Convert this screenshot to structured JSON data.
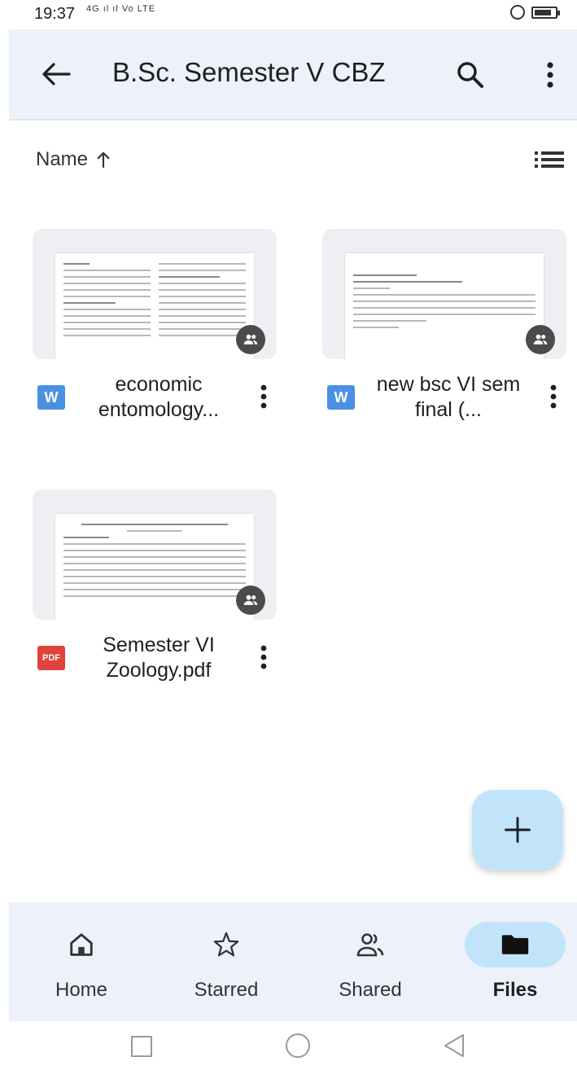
{
  "status_bar": {
    "time": "19:37",
    "network": "4G ıl ıl Vo LTE"
  },
  "app_bar": {
    "title": "B.Sc. Semester V CBZ",
    "back_icon": "arrow-left-icon",
    "search_icon": "search-icon",
    "more_icon": "more-vert-icon"
  },
  "sort": {
    "label": "Name",
    "direction_icon": "arrow-up-icon",
    "view_toggle_icon": "list-view-icon"
  },
  "files": [
    {
      "name": "economic entomology...",
      "type": "word",
      "type_label": "W",
      "shared": true
    },
    {
      "name": "new bsc VI sem final (...",
      "type": "word",
      "type_label": "W",
      "shared": true
    },
    {
      "name": "Semester VI Zoology.pdf",
      "type": "pdf",
      "type_label": "PDF",
      "shared": true
    }
  ],
  "fab": {
    "icon": "plus-icon"
  },
  "bottom_nav": {
    "items": [
      {
        "label": "Home",
        "icon": "home-icon",
        "active": false
      },
      {
        "label": "Starred",
        "icon": "star-icon",
        "active": false
      },
      {
        "label": "Shared",
        "icon": "shared-people-icon",
        "active": false
      },
      {
        "label": "Files",
        "icon": "folder-icon",
        "active": true
      }
    ]
  },
  "colors": {
    "app_bar_bg": "#edf1f9",
    "accent_pill": "#c2e4fb",
    "word_icon": "#4a90e2",
    "pdf_icon": "#e0433a"
  }
}
